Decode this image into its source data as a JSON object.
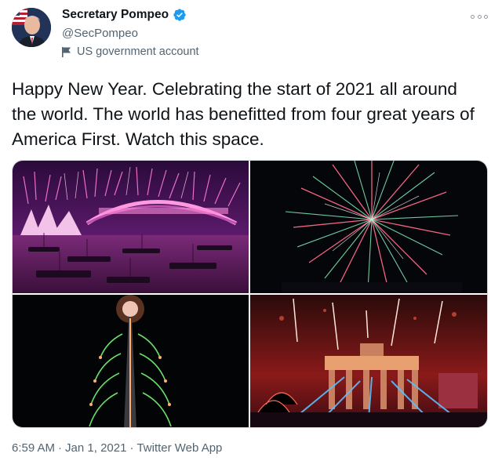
{
  "author": {
    "display_name": "Secretary Pompeo",
    "handle": "@SecPompeo",
    "verified": true,
    "account_label": "US government account",
    "avatar_icon": "avatar-photo",
    "label_icon": "flag-icon"
  },
  "tweet": {
    "text": "Happy New Year. Celebrating the start of 2021 all around the world. The world has benefitted from four great years of America First. Watch this space."
  },
  "media": [
    {
      "name": "sydney-fireworks-photo"
    },
    {
      "name": "fireworks-burst-photo"
    },
    {
      "name": "burj-khalifa-fireworks-photo"
    },
    {
      "name": "brandenburg-gate-fireworks-photo"
    }
  ],
  "meta": {
    "time": "6:59 AM",
    "separator": "·",
    "date": "Jan 1, 2021",
    "source": "Twitter Web App"
  },
  "colors": {
    "verified_blue": "#1d9bf0",
    "secondary_text": "#536471"
  }
}
